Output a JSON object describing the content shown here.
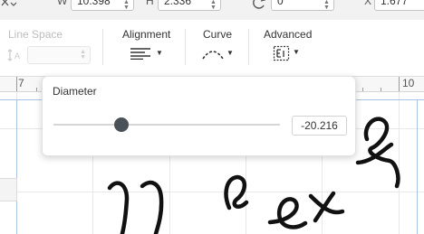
{
  "top_bar": {
    "width_label": "W",
    "width_value": "10.398",
    "height_label": "H",
    "height_value": "2.336",
    "rotate_value": "0",
    "x_label": "X",
    "x_value": "1.677"
  },
  "toolbar": {
    "line_space": {
      "label": "Line Space",
      "icon": "line-spacing-icon",
      "enabled": false
    },
    "alignment": {
      "label": "Alignment",
      "icon": "align-left-icon"
    },
    "curve": {
      "label": "Curve",
      "icon": "curve-text-icon"
    },
    "advanced": {
      "label": "Advanced",
      "icon": "advanced-text-icon"
    }
  },
  "ruler": {
    "labels": [
      "7",
      "10"
    ]
  },
  "diameter_popover": {
    "title": "Diameter",
    "value": "-20.216",
    "slider_position_fraction": 0.3
  },
  "canvas_text": "Text",
  "colors": {
    "accent_selection": "#aac4e6",
    "slider_thumb": "#4a5058",
    "disabled_text": "#bdbdbd"
  }
}
